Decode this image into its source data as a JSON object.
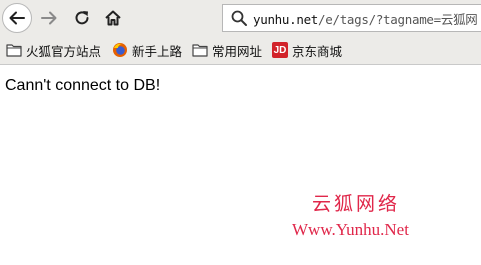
{
  "url_bar": {
    "host": "yunhu.net",
    "path": "/e/tags/?tagname=云狐网"
  },
  "bookmarks": [
    {
      "label": "火狐官方站点",
      "icon": "folder-icon"
    },
    {
      "label": "新手上路",
      "icon": "firefox-icon"
    },
    {
      "label": "常用网址",
      "icon": "folder-icon"
    },
    {
      "label": "京东商城",
      "icon": "jd-icon",
      "icon_text": "JD"
    }
  ],
  "page": {
    "error_message": "Cann't connect to DB!"
  },
  "watermark": {
    "chinese": "云狐网络",
    "english": "Www.Yunhu.Net"
  },
  "colors": {
    "toolbar_bg": "#ecebe8",
    "watermark": "#e0274a",
    "jd_red": "#d2232a"
  }
}
